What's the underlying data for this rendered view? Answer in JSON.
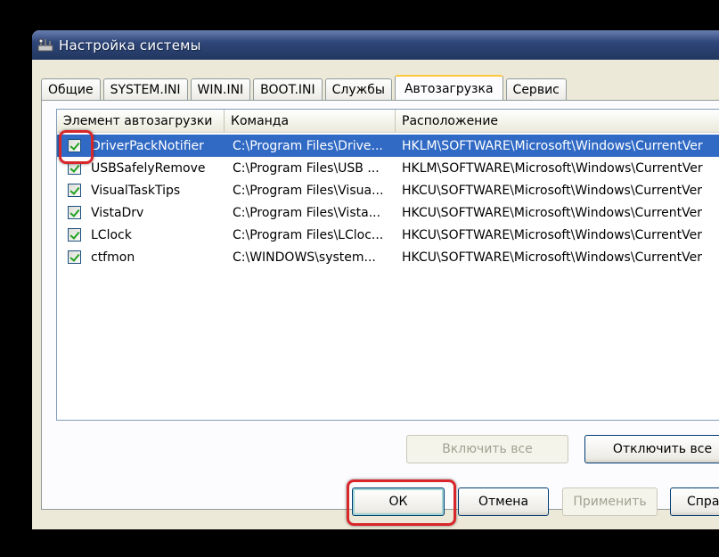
{
  "window": {
    "title": "Настройка системы",
    "icon": "msconfig-icon"
  },
  "tabs": [
    {
      "label": "Общие",
      "active": false
    },
    {
      "label": "SYSTEM.INI",
      "active": false
    },
    {
      "label": "WIN.INI",
      "active": false
    },
    {
      "label": "BOOT.INI",
      "active": false
    },
    {
      "label": "Службы",
      "active": false
    },
    {
      "label": "Автозагрузка",
      "active": true
    },
    {
      "label": "Сервис",
      "active": false
    }
  ],
  "startup_list": {
    "columns": [
      "Элемент автозагрузки",
      "Команда",
      "Расположение"
    ],
    "rows": [
      {
        "checked": true,
        "selected": true,
        "name": "DriverPackNotifier",
        "command": "C:\\Program Files\\Drive...",
        "location": "HKLM\\SOFTWARE\\Microsoft\\Windows\\CurrentVer"
      },
      {
        "checked": true,
        "selected": false,
        "name": "USBSafelyRemove",
        "command": "C:\\Program Files\\USB ...",
        "location": "HKLM\\SOFTWARE\\Microsoft\\Windows\\CurrentVer"
      },
      {
        "checked": true,
        "selected": false,
        "name": "VisualTaskTips",
        "command": "C:\\Program Files\\Visua...",
        "location": "HKCU\\SOFTWARE\\Microsoft\\Windows\\CurrentVer"
      },
      {
        "checked": true,
        "selected": false,
        "name": "VistaDrv",
        "command": "C:\\Program Files\\Vista...",
        "location": "HKCU\\SOFTWARE\\Microsoft\\Windows\\CurrentVer"
      },
      {
        "checked": true,
        "selected": false,
        "name": "LClock",
        "command": "C:\\Program Files\\LCloc...",
        "location": "HKCU\\SOFTWARE\\Microsoft\\Windows\\CurrentVer"
      },
      {
        "checked": true,
        "selected": false,
        "name": "ctfmon",
        "command": "C:\\WINDOWS\\system...",
        "location": "HKCU\\SOFTWARE\\Microsoft\\Windows\\CurrentVer"
      }
    ]
  },
  "panel_buttons": {
    "enable_all": "Включить все",
    "disable_all": "Отключить все"
  },
  "dialog_buttons": {
    "ok": "ОК",
    "cancel": "Отмена",
    "apply": "Применить",
    "help": "Спра"
  },
  "colors": {
    "selection": "#316ac5",
    "highlight": "#d8262b",
    "titlebar": "#2f4679"
  }
}
